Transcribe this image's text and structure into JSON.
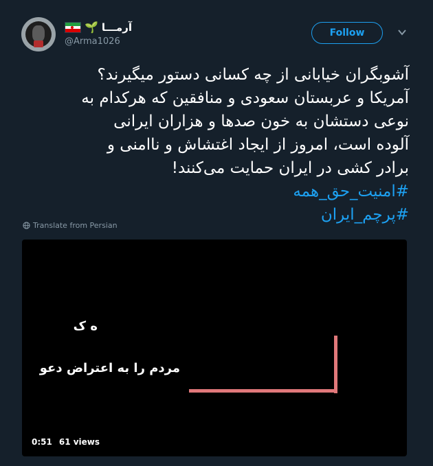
{
  "tweet": {
    "display_name": "آرمـــا",
    "handle": "@Arma1026",
    "follow_label": "Follow",
    "text_lines": [
      "آشوبگران خیابانی از چه کسانی دستور میگیرند؟",
      "آمریکا و عربستان سعودی و منافقین که هرکدام به",
      "نوعی دستشان به خون صدها و هزاران ایرانی",
      "آلوده است، امروز از  ایجاد اغتشاش و ناامنی و",
      "برادر کشی در ایران حمایت می‌کنند!"
    ],
    "hashtags": [
      "#امنیت_حق_همه",
      "#پرچم_ایران"
    ],
    "translate_label": "Translate from Persian"
  },
  "video": {
    "overlay_text_1": "ه ک",
    "overlay_text_2": "مردم را به اعتراض دعو",
    "duration": "0:51",
    "views": "61 views"
  },
  "icons": {
    "flag": "iran-flag-icon",
    "sprout": "sprout-icon",
    "caret": "chevron-down-icon",
    "globe": "globe-icon"
  },
  "colors": {
    "background": "#15202b",
    "accent": "#1da1f2",
    "muted": "#8899a6",
    "bracket": "#e0787a"
  }
}
